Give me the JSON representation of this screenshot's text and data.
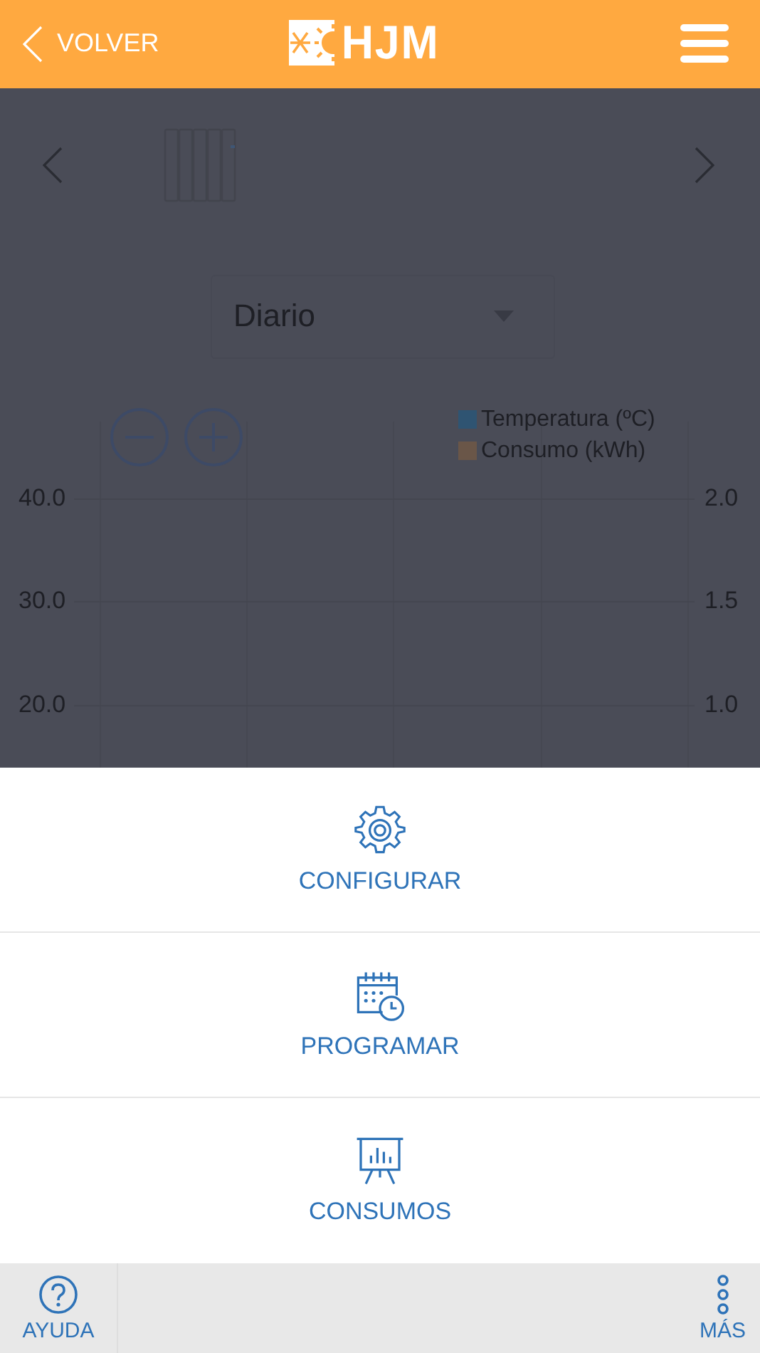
{
  "header": {
    "back_label": "VOLVER",
    "logo_text": "HJM"
  },
  "device_nav": {
    "period_select": {
      "value": "Diario"
    }
  },
  "chart": {
    "left_axis_labels": [
      "40.0",
      "30.0",
      "20.0"
    ],
    "right_axis_labels": [
      "2.0",
      "1.5",
      "1.0"
    ],
    "legend": [
      {
        "label": "Temperatura (ºC)",
        "color": "#2f5472"
      },
      {
        "label": "Consumo (kWh)",
        "color": "#6a5648"
      }
    ]
  },
  "action_sheet": [
    {
      "kind": "settings",
      "label": "CONFIGURAR"
    },
    {
      "kind": "schedule",
      "label": "PROGRAMAR"
    },
    {
      "kind": "consumption",
      "label": "CONSUMOS"
    }
  ],
  "bottom_bar": {
    "help_label": "AYUDA",
    "more_label": "MÁS"
  }
}
